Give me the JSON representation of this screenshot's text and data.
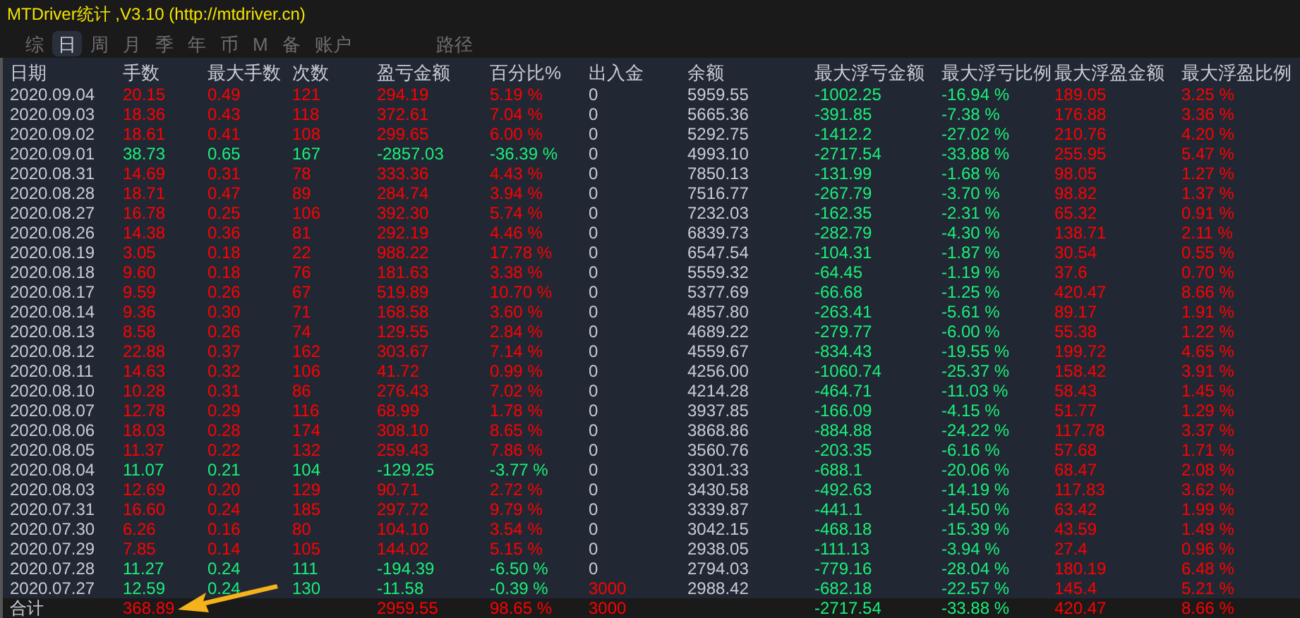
{
  "window": {
    "title": "MTDriver统计 ,V3.10 (http://mtdriver.cn)"
  },
  "tabs": [
    {
      "label": "综",
      "selected": false
    },
    {
      "label": "日",
      "selected": true
    },
    {
      "label": "周",
      "selected": false
    },
    {
      "label": "月",
      "selected": false
    },
    {
      "label": "季",
      "selected": false
    },
    {
      "label": "年",
      "selected": false
    },
    {
      "label": "币",
      "selected": false
    },
    {
      "label": "M",
      "selected": false
    },
    {
      "label": "备",
      "selected": false
    },
    {
      "label": "账户",
      "selected": false
    },
    {
      "label": "路径",
      "selected": false
    }
  ],
  "table": {
    "columns": [
      "日期",
      "手数",
      "最大手数",
      "次数",
      "盈亏金额",
      "百分比%",
      "出入金",
      "余额",
      "最大浮亏金额",
      "最大浮亏比例",
      "最大浮盈金额",
      "最大浮盈比例"
    ],
    "rows": [
      {
        "loss": false,
        "deposit_marked": false,
        "cells": [
          "2020.09.04",
          "20.15",
          "0.49",
          "121",
          "294.19",
          "5.19 %",
          "0",
          "5959.55",
          "-1002.25",
          "-16.94 %",
          "189.05",
          "3.25 %"
        ]
      },
      {
        "loss": false,
        "deposit_marked": false,
        "cells": [
          "2020.09.03",
          "18.36",
          "0.43",
          "118",
          "372.61",
          "7.04 %",
          "0",
          "5665.36",
          "-391.85",
          "-7.38 %",
          "176.88",
          "3.36 %"
        ]
      },
      {
        "loss": false,
        "deposit_marked": false,
        "cells": [
          "2020.09.02",
          "18.61",
          "0.41",
          "108",
          "299.65",
          "6.00 %",
          "0",
          "5292.75",
          "-1412.2",
          "-27.02 %",
          "210.76",
          "4.20 %"
        ]
      },
      {
        "loss": true,
        "deposit_marked": false,
        "cells": [
          "2020.09.01",
          "38.73",
          "0.65",
          "167",
          "-2857.03",
          "-36.39 %",
          "0",
          "4993.10",
          "-2717.54",
          "-33.88 %",
          "255.95",
          "5.47 %"
        ]
      },
      {
        "loss": false,
        "deposit_marked": false,
        "cells": [
          "2020.08.31",
          "14.69",
          "0.31",
          "78",
          "333.36",
          "4.43 %",
          "0",
          "7850.13",
          "-131.99",
          "-1.68 %",
          "98.05",
          "1.27 %"
        ]
      },
      {
        "loss": false,
        "deposit_marked": false,
        "cells": [
          "2020.08.28",
          "18.71",
          "0.47",
          "89",
          "284.74",
          "3.94 %",
          "0",
          "7516.77",
          "-267.79",
          "-3.70 %",
          "98.82",
          "1.37 %"
        ]
      },
      {
        "loss": false,
        "deposit_marked": false,
        "cells": [
          "2020.08.27",
          "16.78",
          "0.25",
          "106",
          "392.30",
          "5.74 %",
          "0",
          "7232.03",
          "-162.35",
          "-2.31 %",
          "65.32",
          "0.91 %"
        ]
      },
      {
        "loss": false,
        "deposit_marked": false,
        "cells": [
          "2020.08.26",
          "14.38",
          "0.36",
          "81",
          "292.19",
          "4.46 %",
          "0",
          "6839.73",
          "-282.79",
          "-4.30 %",
          "138.71",
          "2.11 %"
        ]
      },
      {
        "loss": false,
        "deposit_marked": false,
        "cells": [
          "2020.08.19",
          "3.05",
          "0.18",
          "22",
          "988.22",
          "17.78 %",
          "0",
          "6547.54",
          "-104.31",
          "-1.87 %",
          "30.54",
          "0.55 %"
        ]
      },
      {
        "loss": false,
        "deposit_marked": false,
        "cells": [
          "2020.08.18",
          "9.60",
          "0.18",
          "76",
          "181.63",
          "3.38 %",
          "0",
          "5559.32",
          "-64.45",
          "-1.19 %",
          "37.6",
          "0.70 %"
        ]
      },
      {
        "loss": false,
        "deposit_marked": false,
        "cells": [
          "2020.08.17",
          "9.59",
          "0.26",
          "67",
          "519.89",
          "10.70 %",
          "0",
          "5377.69",
          "-66.68",
          "-1.25 %",
          "420.47",
          "8.66 %"
        ]
      },
      {
        "loss": false,
        "deposit_marked": false,
        "cells": [
          "2020.08.14",
          "9.36",
          "0.30",
          "71",
          "168.58",
          "3.60 %",
          "0",
          "4857.80",
          "-263.41",
          "-5.61 %",
          "89.17",
          "1.91 %"
        ]
      },
      {
        "loss": false,
        "deposit_marked": false,
        "cells": [
          "2020.08.13",
          "8.58",
          "0.26",
          "74",
          "129.55",
          "2.84 %",
          "0",
          "4689.22",
          "-279.77",
          "-6.00 %",
          "55.38",
          "1.22 %"
        ]
      },
      {
        "loss": false,
        "deposit_marked": false,
        "cells": [
          "2020.08.12",
          "22.88",
          "0.37",
          "162",
          "303.67",
          "7.14 %",
          "0",
          "4559.67",
          "-834.43",
          "-19.55 %",
          "199.72",
          "4.65 %"
        ]
      },
      {
        "loss": false,
        "deposit_marked": false,
        "cells": [
          "2020.08.11",
          "14.63",
          "0.32",
          "106",
          "41.72",
          "0.99 %",
          "0",
          "4256.00",
          "-1060.74",
          "-25.37 %",
          "158.42",
          "3.91 %"
        ]
      },
      {
        "loss": false,
        "deposit_marked": false,
        "cells": [
          "2020.08.10",
          "10.28",
          "0.31",
          "86",
          "276.43",
          "7.02 %",
          "0",
          "4214.28",
          "-464.71",
          "-11.03 %",
          "58.43",
          "1.45 %"
        ]
      },
      {
        "loss": false,
        "deposit_marked": false,
        "cells": [
          "2020.08.07",
          "12.78",
          "0.29",
          "116",
          "68.99",
          "1.78 %",
          "0",
          "3937.85",
          "-166.09",
          "-4.15 %",
          "51.77",
          "1.29 %"
        ]
      },
      {
        "loss": false,
        "deposit_marked": false,
        "cells": [
          "2020.08.06",
          "18.03",
          "0.28",
          "174",
          "308.10",
          "8.65 %",
          "0",
          "3868.86",
          "-884.88",
          "-24.22 %",
          "117.78",
          "3.37 %"
        ]
      },
      {
        "loss": false,
        "deposit_marked": false,
        "cells": [
          "2020.08.05",
          "11.37",
          "0.22",
          "132",
          "259.43",
          "7.86 %",
          "0",
          "3560.76",
          "-203.35",
          "-6.16 %",
          "57.68",
          "1.71 %"
        ]
      },
      {
        "loss": true,
        "deposit_marked": false,
        "cells": [
          "2020.08.04",
          "11.07",
          "0.21",
          "104",
          "-129.25",
          "-3.77 %",
          "0",
          "3301.33",
          "-688.1",
          "-20.06 %",
          "68.47",
          "2.08 %"
        ]
      },
      {
        "loss": false,
        "deposit_marked": false,
        "cells": [
          "2020.08.03",
          "12.69",
          "0.20",
          "129",
          "90.71",
          "2.72 %",
          "0",
          "3430.58",
          "-492.63",
          "-14.19 %",
          "117.83",
          "3.62 %"
        ]
      },
      {
        "loss": false,
        "deposit_marked": false,
        "cells": [
          "2020.07.31",
          "16.60",
          "0.24",
          "185",
          "297.72",
          "9.79 %",
          "0",
          "3339.87",
          "-441.1",
          "-14.50 %",
          "63.42",
          "1.99 %"
        ]
      },
      {
        "loss": false,
        "deposit_marked": false,
        "cells": [
          "2020.07.30",
          "6.26",
          "0.16",
          "80",
          "104.10",
          "3.54 %",
          "0",
          "3042.15",
          "-468.18",
          "-15.39 %",
          "43.59",
          "1.49 %"
        ]
      },
      {
        "loss": false,
        "deposit_marked": false,
        "cells": [
          "2020.07.29",
          "7.85",
          "0.14",
          "105",
          "144.02",
          "5.15 %",
          "0",
          "2938.05",
          "-111.13",
          "-3.94 %",
          "27.4",
          "0.96 %"
        ]
      },
      {
        "loss": true,
        "deposit_marked": false,
        "cells": [
          "2020.07.28",
          "11.27",
          "0.24",
          "111",
          "-194.39",
          "-6.50 %",
          "0",
          "2794.03",
          "-779.16",
          "-28.04 %",
          "180.19",
          "6.48 %"
        ]
      },
      {
        "loss": true,
        "deposit_marked": true,
        "cells": [
          "2020.07.27",
          "12.59",
          "0.24",
          "130",
          "-11.58",
          "-0.39 %",
          "3000",
          "2988.42",
          "-682.18",
          "-22.57 %",
          "145.4",
          "5.21 %"
        ]
      }
    ],
    "total": {
      "loss": false,
      "deposit_marked": true,
      "label": "合计",
      "lots": "368.89",
      "profit_amount": "2959.55",
      "percent": "98.65 %",
      "deposit": "3000",
      "max_float_loss": "-2717.54",
      "max_float_loss_ratio": "-33.88 %",
      "max_float_profit": "420.47",
      "max_float_profit_ratio": "8.66 %"
    }
  }
}
